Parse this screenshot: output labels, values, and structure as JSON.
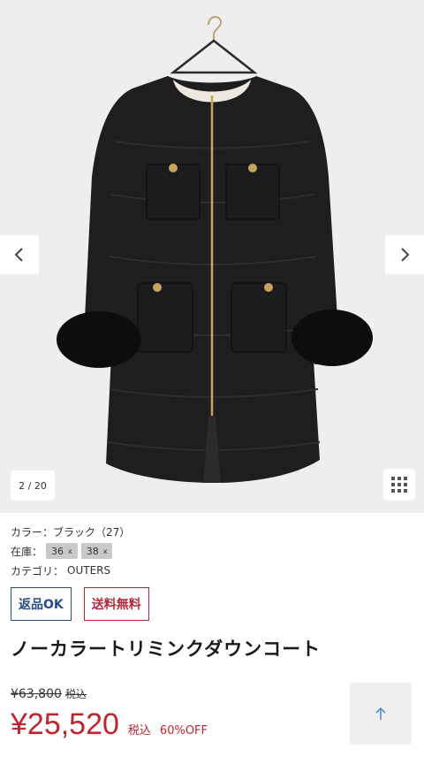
{
  "gallery": {
    "counter": "2 / 20",
    "prev_icon": "chevron-left-icon",
    "next_icon": "chevron-right-icon",
    "grid_icon": "grid-icon"
  },
  "details": {
    "color_label": "カラー：",
    "color_value": "ブラック（27）",
    "stock_label": "在庫：",
    "sizes": [
      "36",
      "38"
    ],
    "size_mark": "x",
    "category_label": "カテゴリ：",
    "category_value": "OUTERS"
  },
  "badges": {
    "return": "返品OK",
    "shipping": "送料無料"
  },
  "product": {
    "title": "ノーカラートリミンクダウンコート"
  },
  "price": {
    "original": "¥63,800",
    "original_tax": "税込",
    "sale": "¥25,520",
    "sale_tax": "税込",
    "discount": "60%OFF"
  },
  "colors": {
    "sale_red": "#c0242e",
    "return_blue": "#2a4d86",
    "shipping_red": "#b3293b"
  },
  "scroll_top_icon": "arrow-up-icon"
}
